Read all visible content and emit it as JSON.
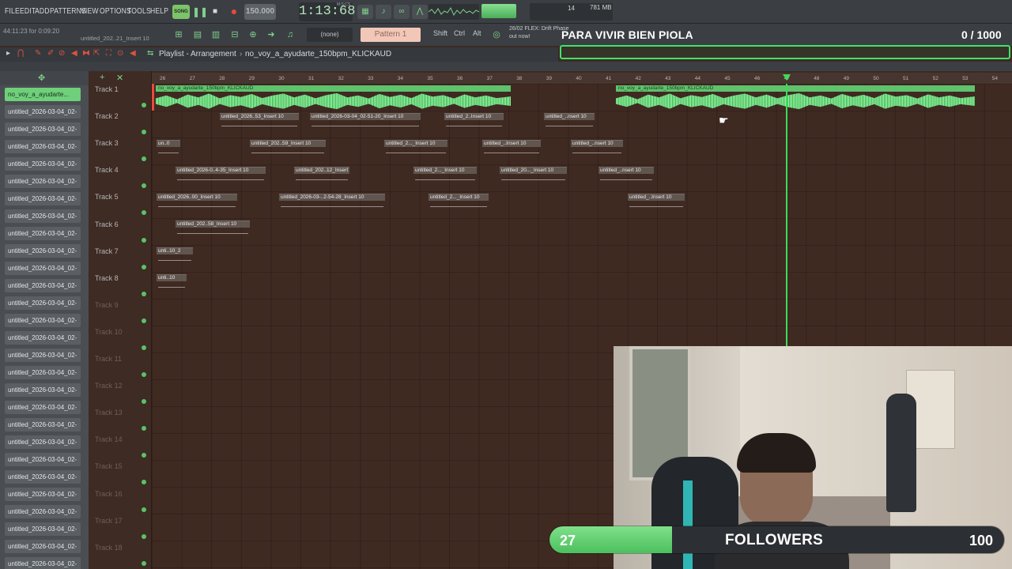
{
  "menu": [
    "FILE",
    "EDIT",
    "ADD",
    "PATTERNS",
    "VIEW",
    "OPTIONS",
    "TOOLS",
    "HELP"
  ],
  "transport": {
    "song_label": "SONG",
    "tempo": "150.000",
    "time": "1:13:68",
    "time_unit": "M:S:CS",
    "cpu": "14",
    "memory": "781 MB",
    "voices": "1"
  },
  "hint": {
    "line1": "44:11:23 for 0:09:20",
    "line2": "untitled_202..21_Insert 10"
  },
  "toolbar2": {
    "pattern_none": "(none)",
    "pattern": "Pattern 1",
    "keys": [
      "Shift",
      "Ctrl",
      "Alt"
    ],
    "news_line1": "26/02  FLEX: Drift Phase",
    "news_line2": "out now!"
  },
  "goal": {
    "title": "PARA VIVIR BIEN PIOLA",
    "count": "0 / 1000",
    "progress": 0
  },
  "playlist": {
    "title": "Playlist - Arrangement",
    "separator": "›",
    "pattern": "no_voy_a_ayudarte_150bpm_KLICKAUD"
  },
  "browser": {
    "items": [
      "no_voy_a_ayudarte...",
      "untitled_2026-03-04_02-",
      "untitled_2026-03-04_02-",
      "untitled_2026-03-04_02-",
      "untitled_2026-03-04_02-",
      "untitled_2026-03-04_02-",
      "untitled_2026-03-04_02-",
      "untitled_2026-03-04_02-",
      "untitled_2026-03-04_02-",
      "untitled_2026-03-04_02-",
      "untitled_2026-03-04_02-",
      "untitled_2026-03-04_02-",
      "untitled_2026-03-04_02-",
      "untitled_2026-03-04_02-",
      "untitled_2026-03-04_02-",
      "untitled_2026-03-04_02-",
      "untitled_2026-03-04_02-",
      "untitled_2026-03-04_02-",
      "untitled_2026-03-04_02-",
      "untitled_2026-03-04_02-",
      "untitled_2026-03-04_02-",
      "untitled_2026-03-04_02-",
      "untitled_2026-03-04_02-",
      "untitled_2026-03-04_02-",
      "untitled_2026-03-04_02-",
      "untitled_2026-03-04_02-",
      "untitled_2026-03-04_02-",
      "untitled_2026-03-04_02-",
      "untitled_2026-03-04_02-"
    ]
  },
  "tracks": [
    "Track 1",
    "Track 2",
    "Track 3",
    "Track 4",
    "Track 5",
    "Track 6",
    "Track 7",
    "Track 8",
    "Track 9",
    "Track 10",
    "Track 11",
    "Track 12",
    "Track 13",
    "Track 14",
    "Track 15",
    "Track 16",
    "Track 17",
    "Track 18"
  ],
  "ruler": [
    "26",
    "27",
    "28",
    "29",
    "30",
    "31",
    "32",
    "33",
    "34",
    "35",
    "36",
    "37",
    "38",
    "39",
    "40",
    "41",
    "42",
    "43",
    "44",
    "45",
    "46",
    "47",
    "48",
    "49",
    "50",
    "51",
    "52",
    "53",
    "54"
  ],
  "clips": {
    "audio": "no_voy_a_ayudarte_150bpm_KLICKAUD",
    "t2": [
      "untitled_2026..53_Insert 10",
      "untitled_2026-03-04_02-51-20_Insert 10",
      "untitled_2..Insert 10",
      "untitled_..nsert 10"
    ],
    "t3": [
      "un..0",
      "untitled_202..59_Insert 10",
      "untitled_2..._Insert 10",
      "untitled_..Insert 10",
      "untitled_..nsert 10"
    ],
    "t4": [
      "untitled_2026-0..4-35_Insert 10",
      "untitled_202..12_Insert 10",
      "untitled_2..._Insert 10",
      "untitled_20..._Insert 10",
      "untitled_..nsert 10"
    ],
    "t5": [
      "untitled_2026..00_Insert 10",
      "untitled_2026-03-..2-54-28_Insert 10",
      "untitled_2..._Insert 10",
      "untitled_..Insert 10"
    ],
    "t6": [
      "untitled_202..58_Insert 10"
    ],
    "t7": [
      "unti..10_2"
    ],
    "t8": [
      "unti..10"
    ]
  },
  "followers": {
    "current": "27",
    "label": "FOLLOWERS",
    "goal": "100",
    "progress": 0.27
  },
  "colors": {
    "accent": "#5fc26d",
    "playhead": "#3ddc58",
    "record": "#e74a3c",
    "playlist_bg": "#3f2a22"
  }
}
